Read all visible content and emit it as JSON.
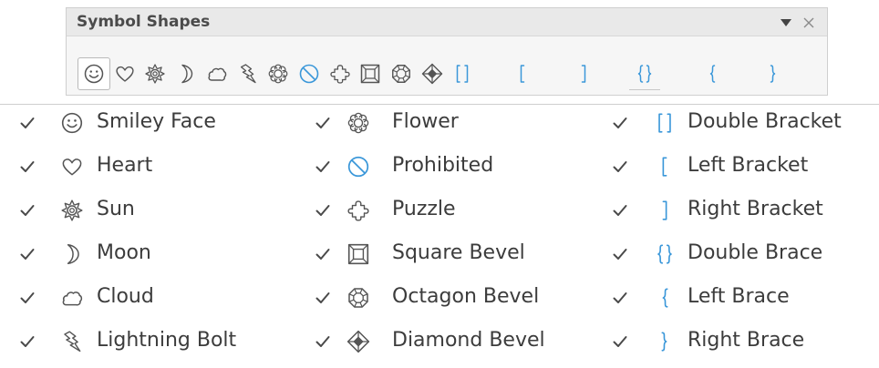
{
  "toolbar": {
    "title": "Symbol Shapes",
    "dropdown_icon": "triangle-down-icon",
    "close_icon": "close-icon",
    "selected_index": 0,
    "buttons": [
      {
        "name": "smiley-face",
        "icon": "smiley-face-icon"
      },
      {
        "name": "heart",
        "icon": "heart-icon"
      },
      {
        "name": "sun",
        "icon": "sun-icon"
      },
      {
        "name": "moon",
        "icon": "moon-icon"
      },
      {
        "name": "cloud",
        "icon": "cloud-icon"
      },
      {
        "name": "lightning-bolt",
        "icon": "lightning-bolt-icon"
      },
      {
        "name": "flower",
        "icon": "flower-icon"
      },
      {
        "name": "prohibited",
        "icon": "prohibited-icon"
      },
      {
        "name": "puzzle",
        "icon": "puzzle-icon"
      },
      {
        "name": "square-bevel",
        "icon": "square-bevel-icon"
      },
      {
        "name": "octagon-bevel",
        "icon": "octagon-bevel-icon"
      },
      {
        "name": "diamond-bevel",
        "icon": "diamond-bevel-icon"
      },
      {
        "name": "double-bracket",
        "icon": "double-bracket-icon"
      },
      {
        "name": "left-bracket",
        "icon": "left-bracket-icon"
      },
      {
        "name": "right-bracket",
        "icon": "right-bracket-icon"
      },
      {
        "name": "double-brace",
        "icon": "double-brace-icon"
      },
      {
        "name": "left-brace",
        "icon": "left-brace-icon"
      },
      {
        "name": "right-brace",
        "icon": "right-brace-icon"
      }
    ]
  },
  "menu": {
    "columns": [
      {
        "items": [
          {
            "label": "Smiley Face",
            "checked": true,
            "icon": "smiley-face-icon"
          },
          {
            "label": "Heart",
            "checked": true,
            "icon": "heart-icon"
          },
          {
            "label": "Sun",
            "checked": true,
            "icon": "sun-icon"
          },
          {
            "label": "Moon",
            "checked": true,
            "icon": "moon-icon"
          },
          {
            "label": "Cloud",
            "checked": true,
            "icon": "cloud-icon"
          },
          {
            "label": "Lightning Bolt",
            "checked": true,
            "icon": "lightning-bolt-icon"
          }
        ]
      },
      {
        "items": [
          {
            "label": "Flower",
            "checked": true,
            "icon": "flower-icon"
          },
          {
            "label": "Prohibited",
            "checked": true,
            "icon": "prohibited-icon"
          },
          {
            "label": "Puzzle",
            "checked": true,
            "icon": "puzzle-icon"
          },
          {
            "label": "Square Bevel",
            "checked": true,
            "icon": "square-bevel-icon"
          },
          {
            "label": "Octagon Bevel",
            "checked": true,
            "icon": "octagon-bevel-icon"
          },
          {
            "label": "Diamond Bevel",
            "checked": true,
            "icon": "diamond-bevel-icon"
          }
        ]
      },
      {
        "items": [
          {
            "label": "Double Bracket",
            "checked": true,
            "icon": "double-bracket-icon"
          },
          {
            "label": "Left Bracket",
            "checked": true,
            "icon": "left-bracket-icon"
          },
          {
            "label": "Right Bracket",
            "checked": true,
            "icon": "right-bracket-icon"
          },
          {
            "label": "Double Brace",
            "checked": true,
            "icon": "double-brace-icon"
          },
          {
            "label": "Left Brace",
            "checked": true,
            "icon": "left-brace-icon"
          },
          {
            "label": "Right Brace",
            "checked": true,
            "icon": "right-brace-icon"
          }
        ]
      }
    ]
  },
  "colors": {
    "icon_gray": "#555555",
    "icon_blue": "#3a97d9",
    "text": "#3c3c3c"
  }
}
